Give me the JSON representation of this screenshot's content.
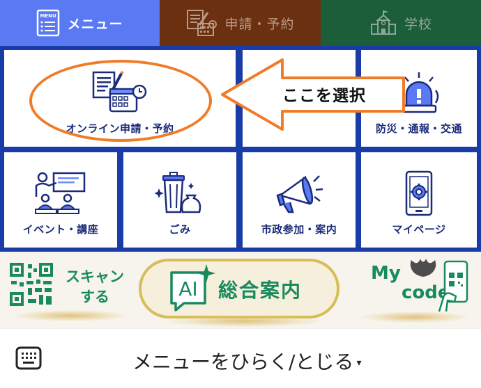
{
  "tabs": [
    {
      "label": "メニュー",
      "icon": "menu-icon",
      "menu_icon_text": "MENU",
      "color": "#5a7af3"
    },
    {
      "label": "申請・予約",
      "icon": "application-icon",
      "color": "#6b3010"
    },
    {
      "label": "学校",
      "icon": "school-icon",
      "color": "#1c5d3a"
    }
  ],
  "grid": {
    "items": [
      {
        "label": "オンライン申請・予約",
        "icon": "online-application-icon"
      },
      {
        "label": "",
        "icon": ""
      },
      {
        "label": "防災・通報・交通",
        "icon": "siren-icon"
      },
      {
        "label": "イベント・講座",
        "icon": "lecture-icon"
      },
      {
        "label": "ごみ",
        "icon": "garbage-icon"
      },
      {
        "label": "市政参加・案内",
        "icon": "megaphone-icon"
      },
      {
        "label": "マイページ",
        "icon": "smartphone-gear-icon"
      }
    ]
  },
  "callout": {
    "text": "ここを選択",
    "color": "#f07c28"
  },
  "banner": {
    "scan": {
      "line1": "スキャン",
      "line2": "する",
      "icon": "qr-code-icon"
    },
    "ai": {
      "badge": "AI",
      "label": "総合案内",
      "icon": "sparkle-icon"
    },
    "mycode": {
      "line1": "My",
      "line2": "code",
      "icon": "phone-qr-icon"
    },
    "accent": "#178a5e"
  },
  "bottom": {
    "label": "メニューをひらく/とじる",
    "caret": "▾",
    "icon": "keyboard-icon"
  }
}
